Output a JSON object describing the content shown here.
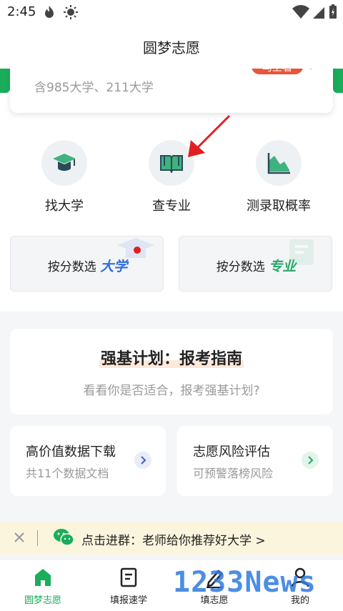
{
  "status_bar": {
    "time": "2:45"
  },
  "app": {
    "title": "圆梦志愿"
  },
  "banner": {
    "subtitle": "含985大学、211大学",
    "pill": "马上看"
  },
  "quick_actions": [
    {
      "label": "找大学",
      "icon": "graduation-cap-icon"
    },
    {
      "label": "查专业",
      "icon": "open-book-icon"
    },
    {
      "label": "测录取概率",
      "icon": "area-chart-icon"
    }
  ],
  "score_select": {
    "university": {
      "prefix": "按分数选",
      "highlight": "大学",
      "highlight_color": "#2f6de0"
    },
    "major": {
      "prefix": "按分数选",
      "highlight": "专业",
      "highlight_color": "#2aa86b"
    }
  },
  "guide": {
    "title": "强基计划：报考指南",
    "subtitle": "看看你是否适合，报考强基计划?"
  },
  "features": [
    {
      "title": "高价值数据下载",
      "subtitle": "共11个数据文档",
      "icon": "chevron-right-icon"
    },
    {
      "title": "志愿风险评估",
      "subtitle": "可预警落榜风险",
      "icon": "chevron-right-icon"
    }
  ],
  "notification": {
    "text": "点击进群：老师给你推荐好大学 >"
  },
  "tabs": [
    {
      "label": "圆梦志愿",
      "icon": "home-icon",
      "active": true
    },
    {
      "label": "填报速学",
      "icon": "document-icon",
      "active": false
    },
    {
      "label": "填志愿",
      "icon": "pen-icon",
      "active": false
    },
    {
      "label": "我的",
      "icon": "user-icon",
      "active": false
    }
  ],
  "watermark": {
    "text": "1233News"
  },
  "colors": {
    "brand_green": "#1aad5c",
    "accent_orange": "#e8553a",
    "notify_bg": "#fbf5de"
  }
}
